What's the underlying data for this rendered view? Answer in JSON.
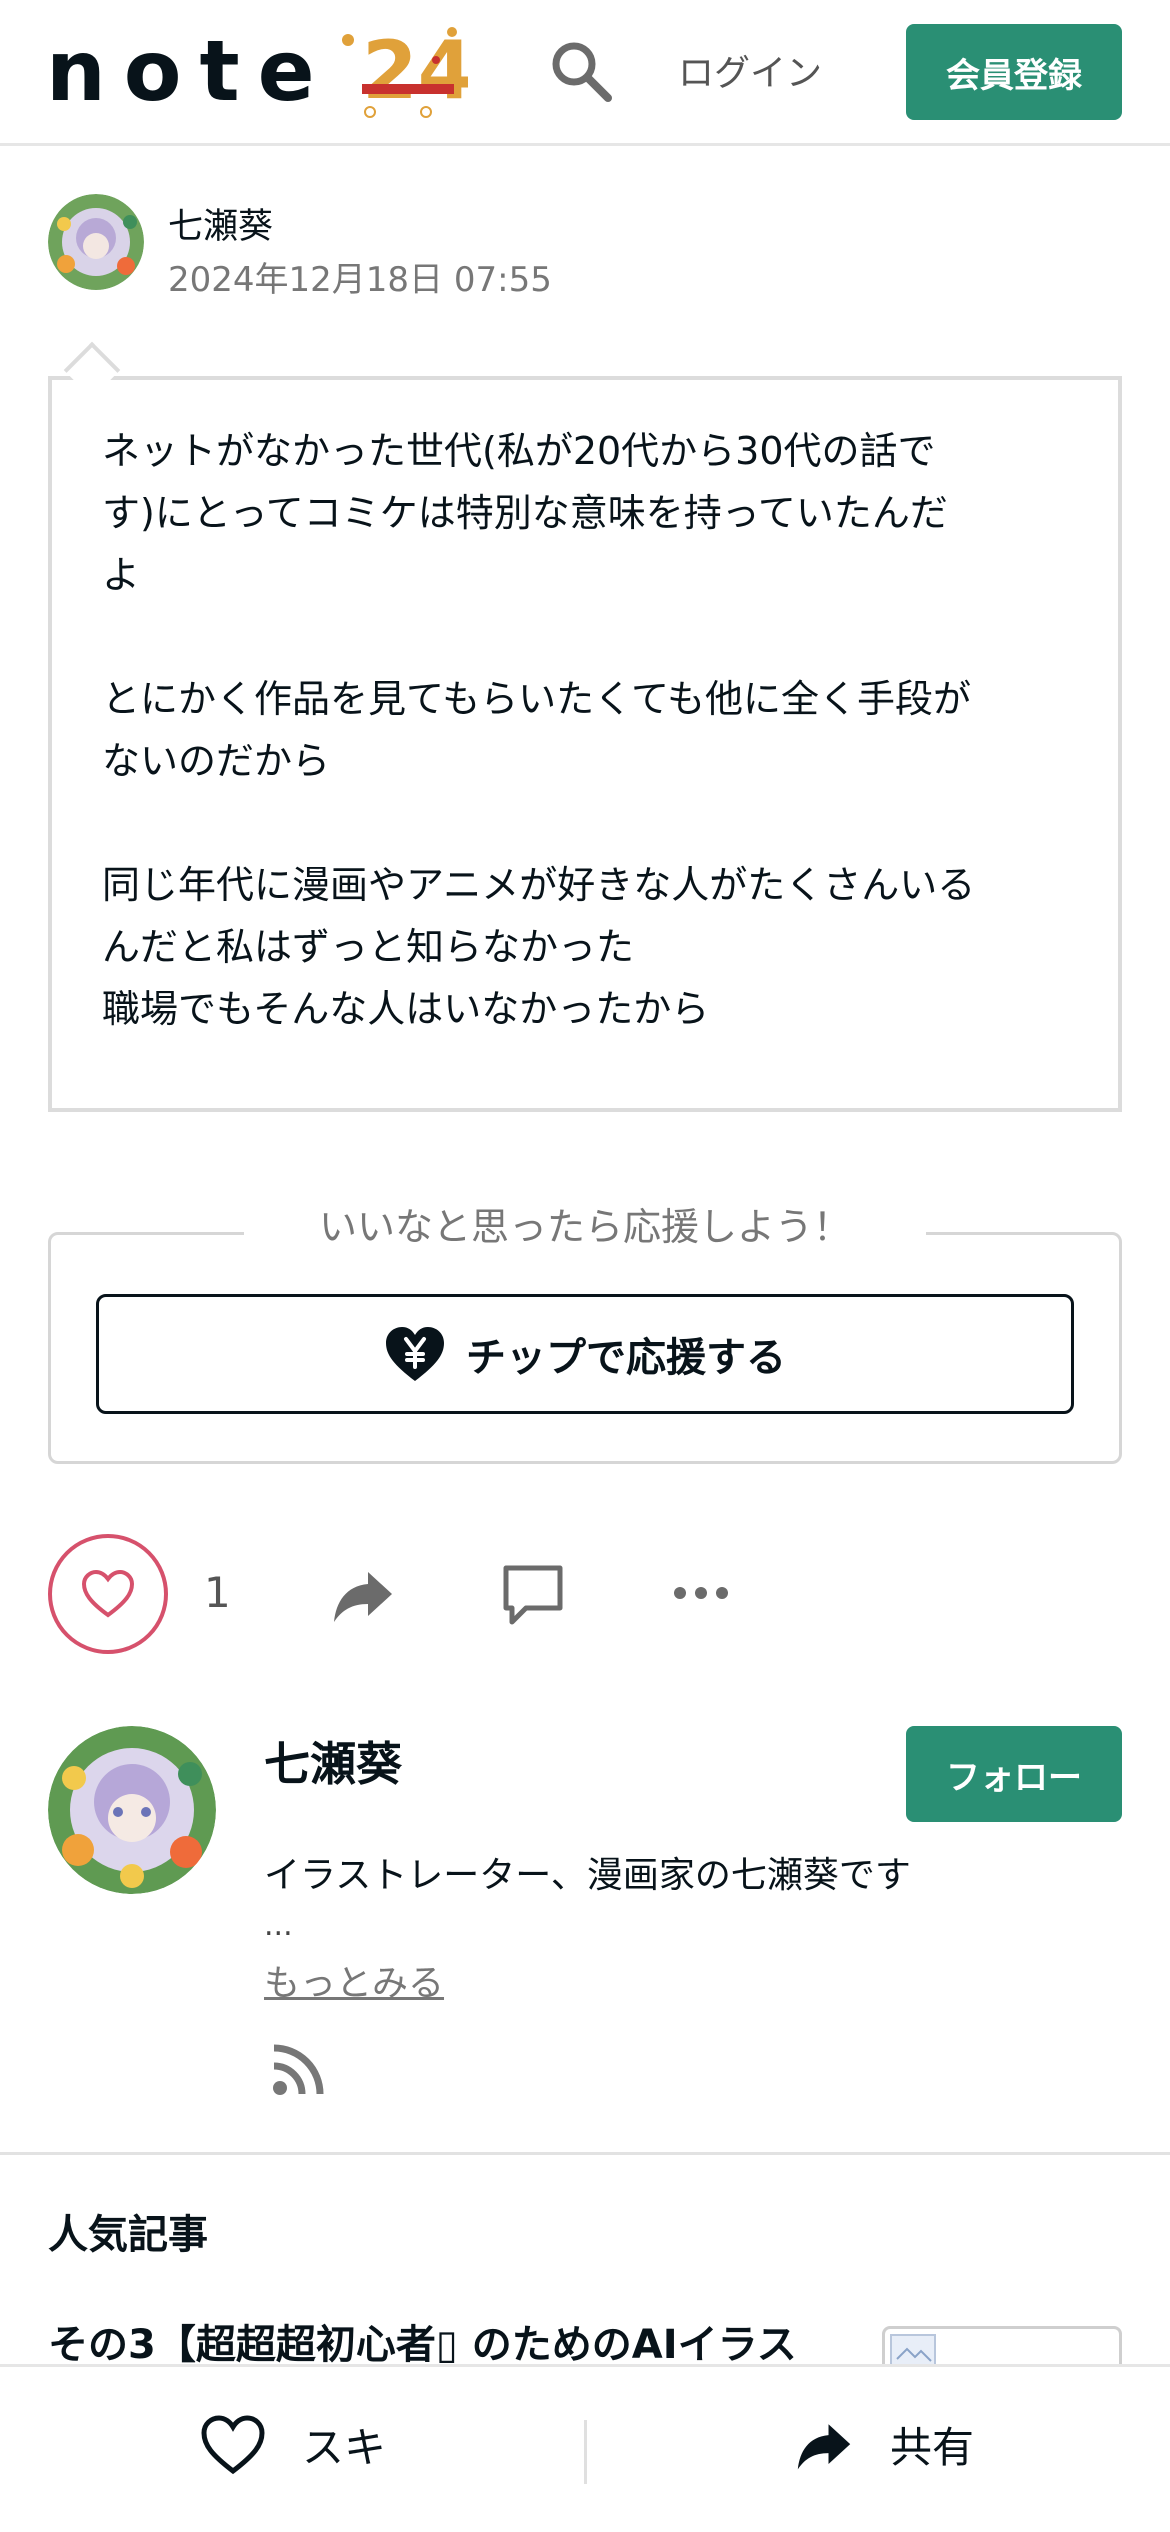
{
  "header": {
    "logo_text": "note",
    "logo_badge": "24",
    "login_label": "ログイン",
    "signup_label": "会員登録"
  },
  "post": {
    "author": "七瀬葵",
    "date": "2024年12月18日 07:55",
    "body": "ネットがなかった世代(私が20代から30代の話で\nす)にとってコミケは特別な意味を持っていたんだ\nよ\n\nとにかく作品を見てもらいたくても他に全く手段が\nないのだから\n\n同じ年代に漫画やアニメが好きな人がたくさんいる\nんだと私はずっと知らなかった\n職場でもそんな人はいなかったから"
  },
  "support": {
    "caption": "いいなと思ったら応援しよう！",
    "tip_label": "チップで応援する"
  },
  "actions": {
    "like_count": "1"
  },
  "profile": {
    "name": "七瀬葵",
    "follow_label": "フォロー",
    "bio": "イラストレーター、漫画家の七瀬葵です",
    "ellipsis": "...",
    "more_label": "もっとみる"
  },
  "popular": {
    "heading": "人気記事",
    "article_title": "その3【超超超初心者▯ のためのAIイラス"
  },
  "bottom_bar": {
    "like_label": "スキ",
    "share_label": "共有"
  },
  "colors": {
    "brand_green": "#2a8f74",
    "like_pink": "#d6516c",
    "text_dark": "#08131a",
    "text_gray": "#777777"
  },
  "icons": [
    "search-icon",
    "heart-yen-icon",
    "heart-icon",
    "share-arrow-icon",
    "comment-icon",
    "more-dots-icon",
    "rss-icon"
  ]
}
